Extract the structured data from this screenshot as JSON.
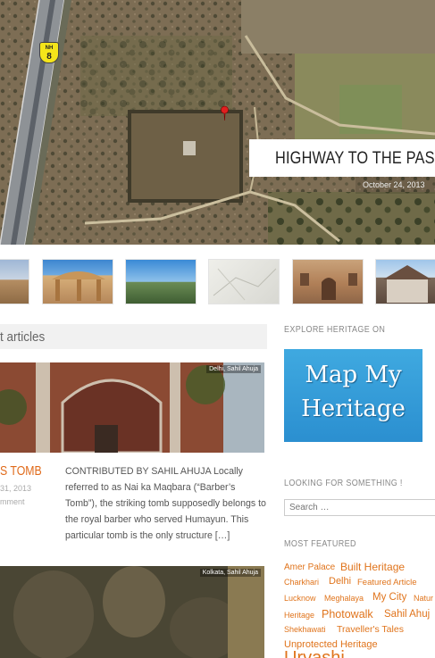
{
  "hero": {
    "title": "HIGHWAY TO THE PAST",
    "date": "October 24, 2013",
    "road_sign": "NH 8",
    "road_sign_top": "NH",
    "road_sign_num": "8"
  },
  "thumbnails": [
    {
      "name": "fort-ramparts"
    },
    {
      "name": "chhatri-pavilion"
    },
    {
      "name": "hill-fort"
    },
    {
      "name": "map-sketch"
    },
    {
      "name": "haveli-courtyard"
    },
    {
      "name": "colonial-building"
    }
  ],
  "main": {
    "section_title": "t articles",
    "articles": [
      {
        "tag": "Delhi, Sahil Ahuja",
        "title": "S TOMB",
        "date": "31, 2013",
        "comment": "mment",
        "excerpt": "CONTRIBUTED BY SAHIL AHUJA Locally referred to as Nai ka Maqbara (“Barber’s Tomb”), the striking tomb supposedly belongs to the royal barber who served Humayun. This particular tomb is the only structure […]"
      },
      {
        "tag": "Kolkata, Sahil Ahuja"
      }
    ]
  },
  "sidebar": {
    "explore_title": "EXPLORE HERITAGE ON",
    "banner_line1": "Map My",
    "banner_line2": "Heritage",
    "search_title": "LOOKING FOR SOMETHING !",
    "search_placeholder": "Search …",
    "featured_title": "MOST FEATURED",
    "tags": [
      "Amer Palace",
      "Built Heritage",
      "Charkhari",
      "Delhi",
      "Featured Article",
      "Lucknow",
      "Meghalaya",
      "My City",
      "Natur",
      "Heritage",
      "Photowalk",
      "Sahil Ahuj",
      "Shekhawati",
      "Traveller's Tales",
      "Unprotected Heritage",
      "Urvashi"
    ]
  },
  "colors": {
    "accent": "#e0741c",
    "banner": "#3fa9e0"
  }
}
